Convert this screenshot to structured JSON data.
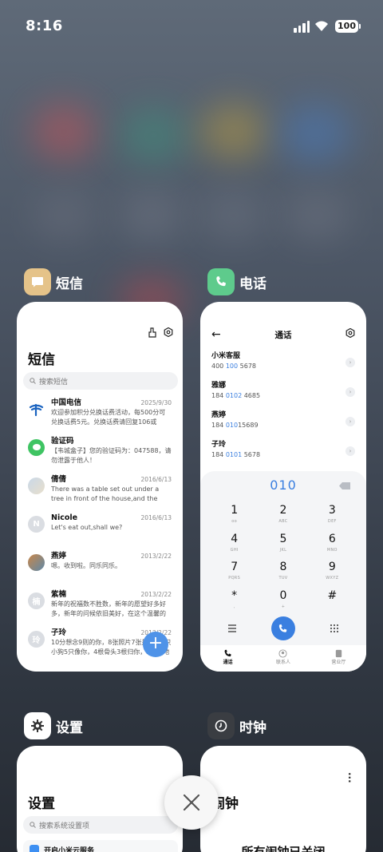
{
  "status_bar": {
    "time": "8:16",
    "battery": "100"
  },
  "recents": [
    {
      "app": "短信",
      "icon": "message-icon",
      "color": "#e5c389"
    },
    {
      "app": "电话",
      "icon": "phone-icon",
      "color": "#5ecb8c"
    },
    {
      "app": "设置",
      "icon": "gear-icon",
      "color": "#ffffff"
    },
    {
      "app": "时钟",
      "icon": "clock-icon",
      "color": "#3a3d42"
    }
  ],
  "sms": {
    "title": "短信",
    "search_placeholder": "搜索短信",
    "messages": [
      {
        "name": "中国电信",
        "date": "2025/9/30",
        "body": "欢迎参加积分兑换话费活动，每500分可兑换话费5元。兑换话费请回复106或jfdh#话费...",
        "avatar": "telecom"
      },
      {
        "name": "验证码",
        "date": "",
        "body": "【韦城盒子】您的验证码为：047588，请勿泄露于他人！",
        "avatar": "green"
      },
      {
        "name": "倩倩",
        "date": "2016/6/13",
        "body": "There was a table set out under a tree in front of the house,and the March Hare an...",
        "avatar": "photo1"
      },
      {
        "name": "Nicole",
        "date": "2016/6/13",
        "body": "Let's eat out,shall we?",
        "avatar": "N"
      },
      {
        "name": "燕婷",
        "date": "2013/2/22",
        "body": "嗯。收到啦。同乐同乐。",
        "avatar": "photo2"
      },
      {
        "name": "紫楠",
        "date": "2013/2/22",
        "body": "新年的祝福数不胜数，新年的愿望好多好多，新年的问候依旧美好，在这个温馨的时刻，...",
        "avatar": "楠"
      },
      {
        "name": "子玲",
        "date": "2013/2/22",
        "body": "10分想念9则的你，8张照片7张是你，6只小狗5只像你，4根骨头3根归你，2爪着地1...",
        "avatar": "玲"
      }
    ],
    "fab": "+"
  },
  "phone": {
    "title": "通话",
    "contacts": [
      {
        "name": "小米客服",
        "num_pre": "400 ",
        "num_hl": "100",
        "num_post": " 5678"
      },
      {
        "name": "雅娜",
        "num_pre": "184 ",
        "num_hl": "0102",
        "num_post": " 4685"
      },
      {
        "name": "燕婷",
        "num_pre": "184 ",
        "num_hl": "010",
        "num_post": "15689"
      },
      {
        "name": "子玲",
        "num_pre": "184 ",
        "num_hl": "0101",
        "num_post": " 5678"
      }
    ],
    "dial_input": "010",
    "keys": [
      {
        "d": "1",
        "l": "oo"
      },
      {
        "d": "2",
        "l": "ABC"
      },
      {
        "d": "3",
        "l": "DEF"
      },
      {
        "d": "4",
        "l": "GHI"
      },
      {
        "d": "5",
        "l": "JKL"
      },
      {
        "d": "6",
        "l": "MNO"
      },
      {
        "d": "7",
        "l": "PQRS"
      },
      {
        "d": "8",
        "l": "TUV"
      },
      {
        "d": "9",
        "l": "WXYZ"
      },
      {
        "d": "*",
        "l": ","
      },
      {
        "d": "0",
        "l": "+"
      },
      {
        "d": "#",
        "l": ""
      }
    ],
    "tabs": [
      "通话",
      "联系人",
      "营业厅"
    ]
  },
  "settings": {
    "title": "设置",
    "search_placeholder": "搜索系统设置项",
    "first_item": "开启小米云服务"
  },
  "clock": {
    "title": "闹钟",
    "status": "所有闹钟已关闭"
  }
}
